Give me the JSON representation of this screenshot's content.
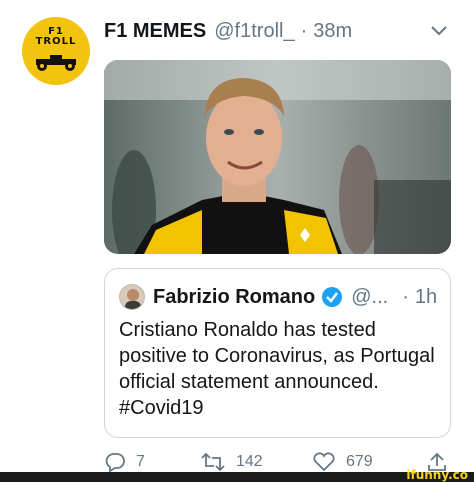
{
  "tweet": {
    "avatar_text": "F1\nTROLL",
    "display_name": "F1 MEMES",
    "handle": "@f1troll_",
    "separator": "·",
    "time": "38m",
    "menu_icon": "chevron-down-icon"
  },
  "quoted_tweet": {
    "display_name": "Fabrizio Romano",
    "verified_icon": "verified-badge-icon",
    "handle": "@...",
    "separator": "·",
    "time": "1h",
    "text": "Cristiano Ronaldo has tested positive to Coronavirus, as Portugal official statement announced. #Covid19"
  },
  "actions": {
    "reply_count": "7",
    "retweet_count": "142",
    "like_count": "679"
  },
  "watermark": "ifunny.co",
  "colors": {
    "avatar_bg": "#f2c30f",
    "muted": "#657786",
    "verified": "#1da1f2",
    "border": "#ccd6dd"
  }
}
